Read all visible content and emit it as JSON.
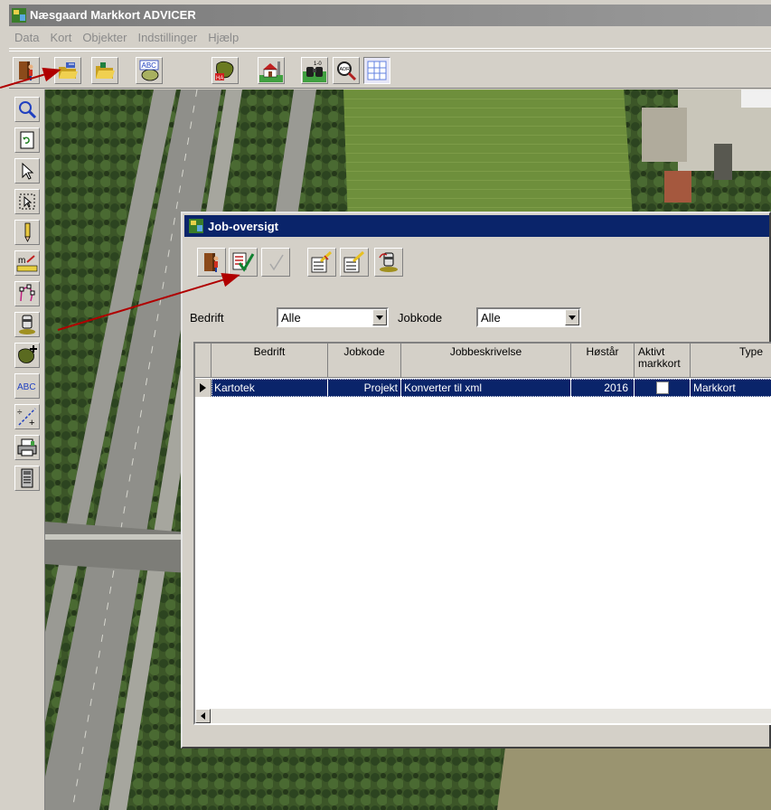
{
  "app": {
    "title": "Næsgaard Markkort ADVICER"
  },
  "menu": [
    "Data",
    "Kort",
    "Objekter",
    "Indstillinger",
    "Hjælp"
  ],
  "toolbar": {
    "abc_text": "ABC",
    "ha_text": "HA",
    "counter_text": "1-0",
    "adr_text": "ADR"
  },
  "lefttoolbar": {
    "measure_text": "m",
    "abc_text": "ABC"
  },
  "dialog": {
    "title": "Job-oversigt",
    "filters": {
      "bedrift_label": "Bedrift",
      "bedrift_value": "Alle",
      "jobkode_label": "Jobkode",
      "jobkode_value": "Alle"
    },
    "table": {
      "headers": [
        "Bedrift",
        "Jobkode",
        "Jobbeskrivelse",
        "Høstår",
        "Aktivt\nmarkkort",
        "Type"
      ],
      "rows": [
        {
          "bedrift": "Kartotek",
          "jobkode": "Projekt",
          "jobbeskrivelse": "Konverter til xml",
          "hostar": "2016",
          "aktivt_markkort": false,
          "type": "Markkort"
        }
      ]
    }
  },
  "colors": {
    "titlebar_active": "#0a246a",
    "titlebar_inactive": "#808080",
    "selected_row": "#0a246a",
    "annotation_arrow": "#b00000"
  }
}
